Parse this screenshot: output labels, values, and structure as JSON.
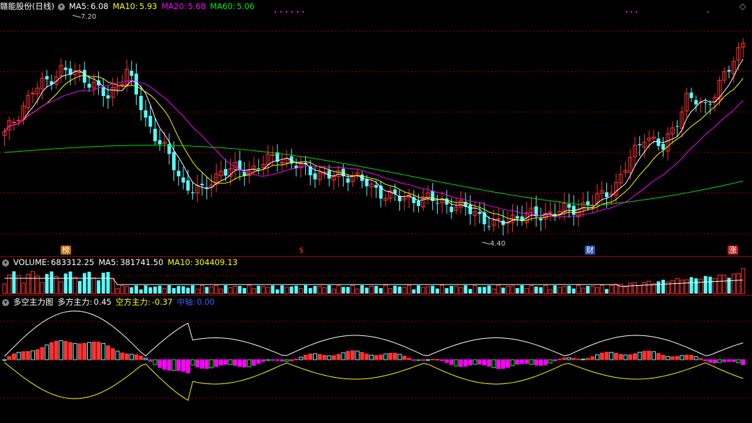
{
  "price_panel": {
    "stock_name": "赣能股份(日线)",
    "ma5_label": "MA5:",
    "ma5_value": "6.08",
    "ma10_label": "MA10:",
    "ma10_value": "5.93",
    "ma20_label": "MA20:",
    "ma20_value": "5.68",
    "ma60_label": "MA60:",
    "ma60_value": "5.06",
    "high_label": "7.20",
    "low_label": "4.40",
    "markers": [
      "榜",
      "$",
      "财",
      "涨"
    ]
  },
  "volume_panel": {
    "title": "VOLUME:",
    "volume_value": "683312.25",
    "ma5_label": "MA5:",
    "ma5_value": "381741.50",
    "ma10_label": "MA10:",
    "ma10_value": "304409.13"
  },
  "indicator_panel": {
    "title": "多空主力图",
    "bull_label": "多方主力:",
    "bull_value": "0.45",
    "bear_label": "空方主力:",
    "bear_value": "-0.37",
    "axis_label": "中轴:",
    "axis_value": "0.00"
  },
  "colors": {
    "up": "#ff3232",
    "down": "#54ffff",
    "ma5": "#ffffff",
    "ma10": "#ffff00",
    "ma20": "#ff00ff",
    "ma60": "#00e000",
    "grid": "#a00000",
    "volume_title": "#ffffff"
  },
  "chart_data": {
    "type": "candlestick",
    "price_range": [
      4.2,
      7.4
    ],
    "candles_count": 130,
    "annotated_high": 7.2,
    "annotated_low": 4.4
  }
}
